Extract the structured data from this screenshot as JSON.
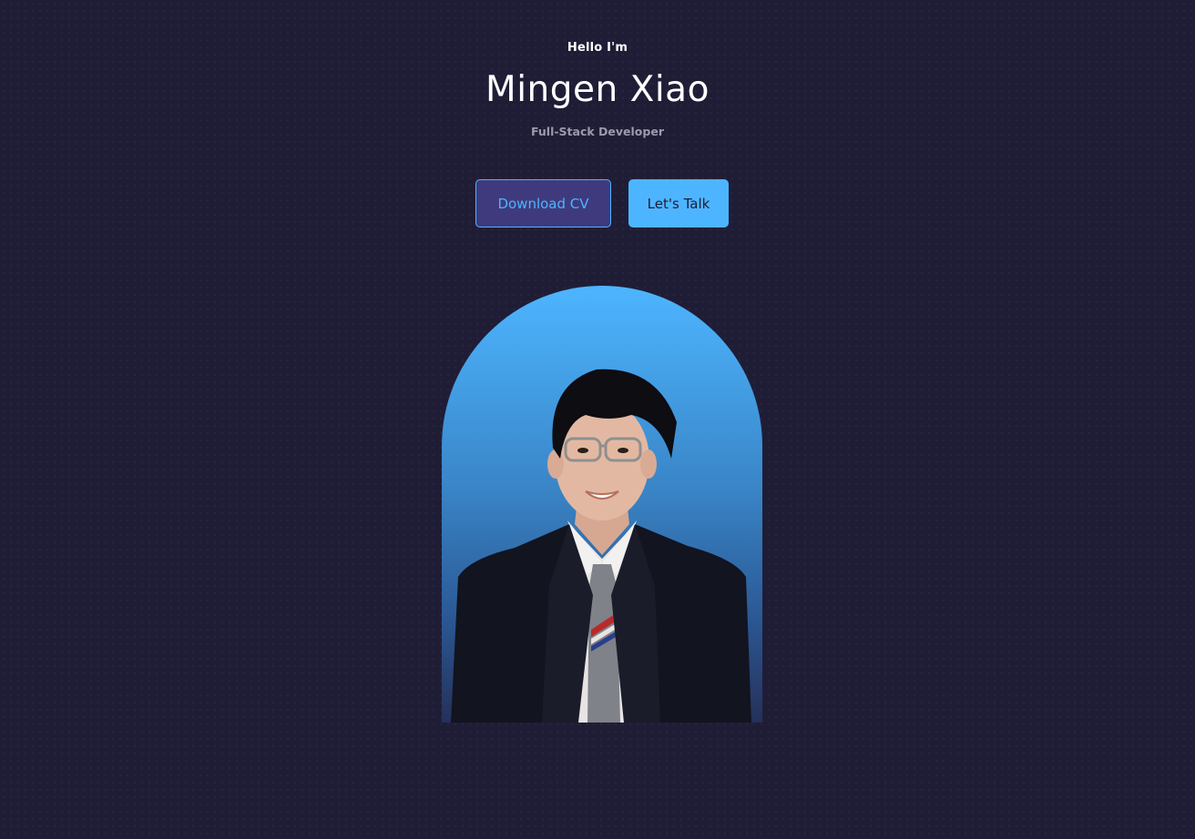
{
  "hero": {
    "greeting": "Hello I'm",
    "name": "Mingen Xiao",
    "role": "Full-Stack Developer"
  },
  "buttons": {
    "download_cv": "Download CV",
    "lets_talk": "Let's Talk"
  },
  "colors": {
    "background": "#1f1d36",
    "accent": "#4db5ff",
    "secondary_button_bg": "#3f3a7e",
    "muted_text": "#9a9bab"
  }
}
